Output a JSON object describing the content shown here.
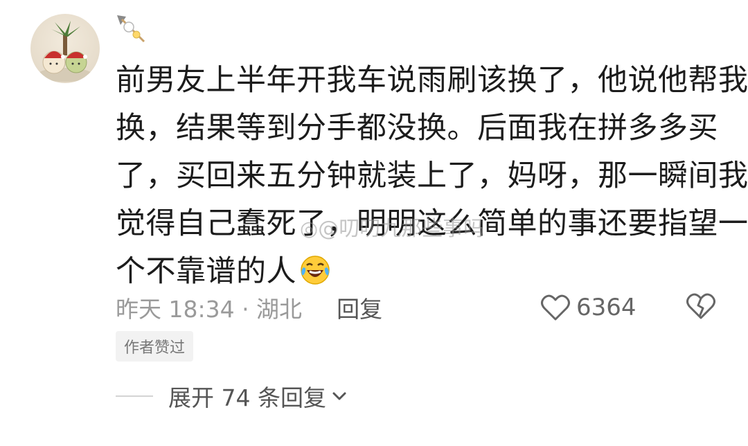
{
  "comment": {
    "lines": [
      "前男友上半年开我车说雨刷该换了，他说他帮我",
      "换，结果等到分手都没换。后面我在拼多多买",
      "了，买回来五分钟就装上了，妈呀，那一瞬间我",
      "觉得自己蠢死了，明明这么简单的事还要指望一",
      "个不靠谱的人"
    ],
    "emoji": "laughing-crying-emoji"
  },
  "watermark": "@叨叨九那些事吗",
  "meta": {
    "time_location": "昨天 18:34 · 湖北",
    "reply_label": "回复"
  },
  "like": {
    "count": "6364",
    "icon": "heart-outline-icon"
  },
  "dislike": {
    "icon": "broken-heart-icon"
  },
  "author_tag": "作者赞过",
  "expand": {
    "label": "展开 74 条回复",
    "icon": "chevron-down-icon"
  },
  "colors": {
    "text": "#1c1c1c",
    "meta": "#9a9a9a",
    "tag_bg": "#f2f2f2"
  }
}
